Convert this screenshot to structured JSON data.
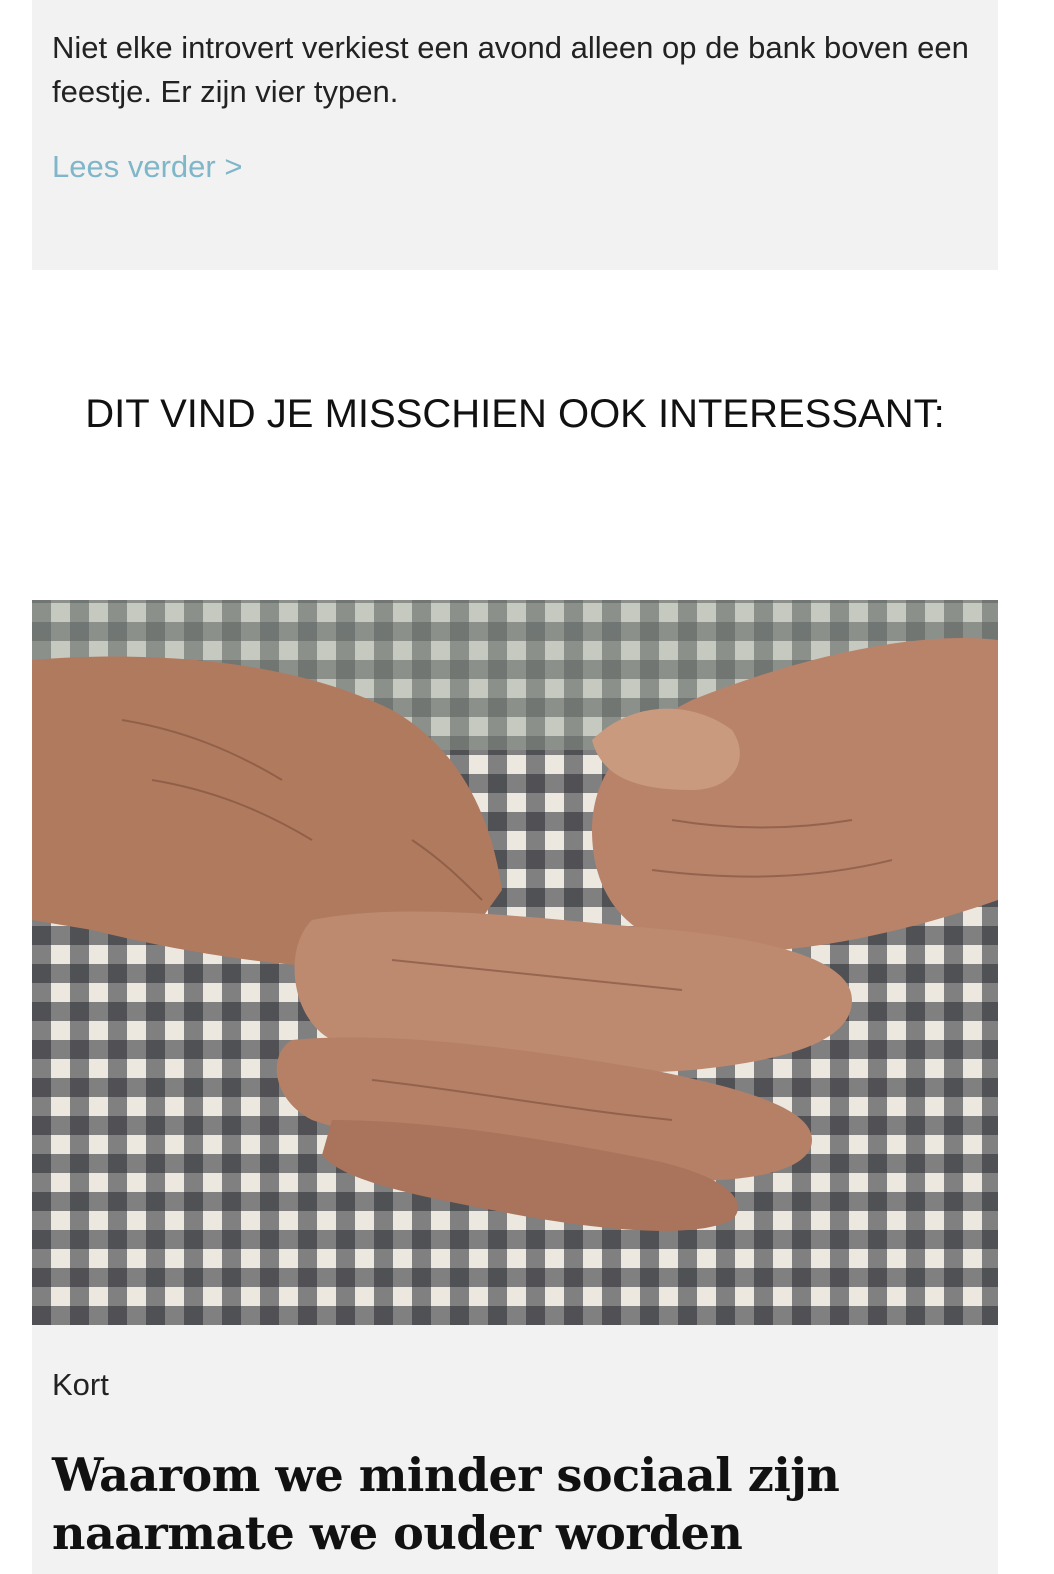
{
  "previous_card": {
    "excerpt": "Niet elke introvert verkiest een avond alleen op de bank boven een feestje. Er zijn vier typen.",
    "read_more_label": "Lees verder >"
  },
  "related_section": {
    "heading": "DIT VIND JE MISSCHIEN OOK INTERESSANT:"
  },
  "related_article": {
    "image_description": "elderly-hands-on-checkered-apron",
    "category": "Kort",
    "title": "Waarom we minder sociaal zijn naarmate we ouder worden"
  },
  "colors": {
    "card_background": "#f2f2f2",
    "link": "#7fb6c9",
    "text": "#222222"
  }
}
